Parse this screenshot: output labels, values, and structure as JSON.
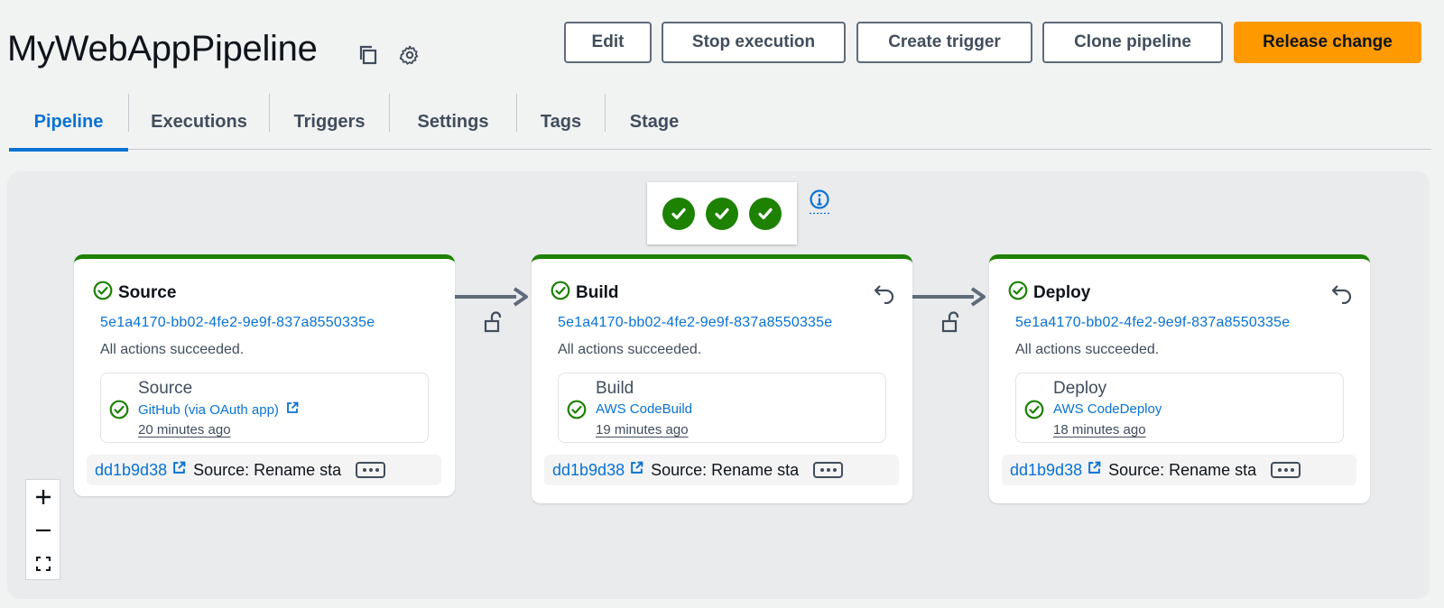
{
  "header": {
    "title": "MyWebAppPipeline",
    "icons": [
      "copy-icon",
      "gear-icon"
    ],
    "buttons": {
      "edit": "Edit",
      "stop": "Stop execution",
      "create_trigger": "Create trigger",
      "clone": "Clone pipeline",
      "release": "Release change"
    }
  },
  "tabs": [
    {
      "label": "Pipeline",
      "active": true
    },
    {
      "label": "Executions"
    },
    {
      "label": "Triggers"
    },
    {
      "label": "Settings"
    },
    {
      "label": "Tags"
    },
    {
      "label": "Stage"
    }
  ],
  "overall_status": {
    "stages_succeeded": 3,
    "icon": "info-icon"
  },
  "stages": [
    {
      "name": "Source",
      "execution_id": "5e1a4170-bb02-4fe2-9e9f-837a8550335e",
      "message": "All actions succeeded.",
      "action": {
        "name": "Source",
        "provider": "GitHub (via OAuth app)",
        "time": "20 minutes ago"
      },
      "commit": {
        "id": "dd1b9d38",
        "message": "Source: Rename sta"
      }
    },
    {
      "name": "Build",
      "execution_id": "5e1a4170-bb02-4fe2-9e9f-837a8550335e",
      "message": "All actions succeeded.",
      "action": {
        "name": "Build",
        "provider": "AWS CodeBuild",
        "time": "19 minutes ago"
      },
      "commit": {
        "id": "dd1b9d38",
        "message": "Source: Rename sta"
      }
    },
    {
      "name": "Deploy",
      "execution_id": "5e1a4170-bb02-4fe2-9e9f-837a8550335e",
      "message": "All actions succeeded.",
      "action": {
        "name": "Deploy",
        "provider": "AWS CodeDeploy",
        "time": "18 minutes ago"
      },
      "commit": {
        "id": "dd1b9d38",
        "message": "Source: Rename sta"
      }
    }
  ],
  "zoom_controls": [
    "zoom-in-icon",
    "zoom-out-icon",
    "fit-view-icon"
  ],
  "colors": {
    "accent": "#0972d3",
    "success": "#1d8102",
    "primary_button": "#ff9900"
  }
}
